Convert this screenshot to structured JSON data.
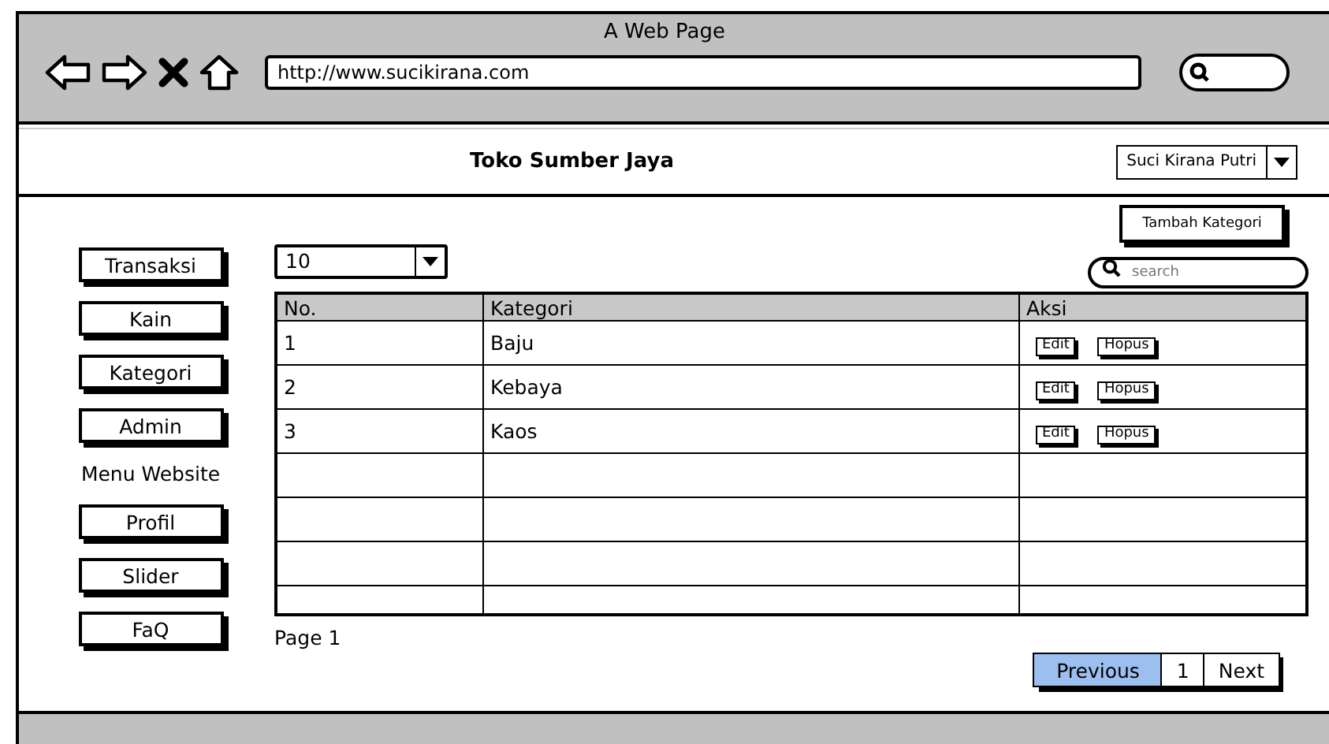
{
  "window": {
    "title": "A Web Page",
    "url": "http://www.sucikirana.com"
  },
  "header": {
    "site_title": "Toko Sumber Jaya",
    "user_menu": "Suci Kirana Putri"
  },
  "sidebar": {
    "items": [
      {
        "kind": "button",
        "label": "Transaksi"
      },
      {
        "kind": "button",
        "label": "Kain"
      },
      {
        "kind": "button",
        "label": "Kategori"
      },
      {
        "kind": "button",
        "label": "Admin"
      },
      {
        "kind": "label",
        "label": "Menu Website"
      },
      {
        "kind": "button",
        "label": "Profil"
      },
      {
        "kind": "button",
        "label": "Slider"
      },
      {
        "kind": "button",
        "label": "FaQ"
      }
    ]
  },
  "toolbar": {
    "page_size": "10",
    "add_button": "Tambah Kategori",
    "search": {
      "placeholder": "search"
    }
  },
  "table": {
    "columns": [
      "No.",
      "Kategori",
      "Aksi"
    ],
    "rows": [
      {
        "kind": "data",
        "no": "1",
        "kategori": "Baju",
        "actions": [
          "Edit",
          "Hopus"
        ]
      },
      {
        "kind": "data",
        "no": "2",
        "kategori": "Kebaya",
        "actions": [
          "Edit",
          "Hopus"
        ]
      },
      {
        "kind": "data",
        "no": "3",
        "kategori": "Kaos",
        "actions": [
          "Edit",
          "Hopus"
        ]
      },
      {
        "kind": "blank"
      },
      {
        "kind": "blank"
      },
      {
        "kind": "blank"
      },
      {
        "kind": "blank"
      }
    ]
  },
  "footer": {
    "page_label": "Page 1",
    "pagination": [
      {
        "label": "Previous",
        "selected": true
      },
      {
        "label": "1",
        "selected": false
      },
      {
        "label": "Next",
        "selected": false
      }
    ]
  }
}
